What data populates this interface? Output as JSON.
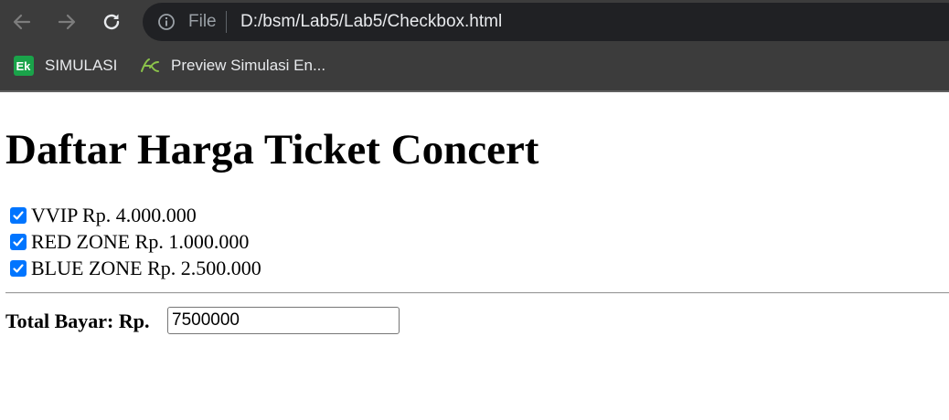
{
  "browser": {
    "file_label": "File",
    "url": "D:/bsm/Lab5/Lab5/Checkbox.html",
    "bookmarks": [
      {
        "label": "SIMULASI",
        "icon": "ek-logo-icon"
      },
      {
        "label": "Preview Simulasi En...",
        "icon": "ek-leaf-icon"
      }
    ]
  },
  "page": {
    "title": "Daftar Harga Ticket Concert",
    "options": [
      {
        "label": "VVIP Rp. 4.000.000",
        "checked": true
      },
      {
        "label": "RED ZONE Rp. 1.000.000",
        "checked": true
      },
      {
        "label": "BLUE ZONE Rp. 2.500.000",
        "checked": true
      }
    ],
    "total_label": "Total Bayar: Rp.",
    "total_value": "7500000"
  },
  "colors": {
    "chrome_bg": "#3c3c3c",
    "omnibox_bg": "#202124",
    "checkbox_accent": "#0075ff"
  }
}
